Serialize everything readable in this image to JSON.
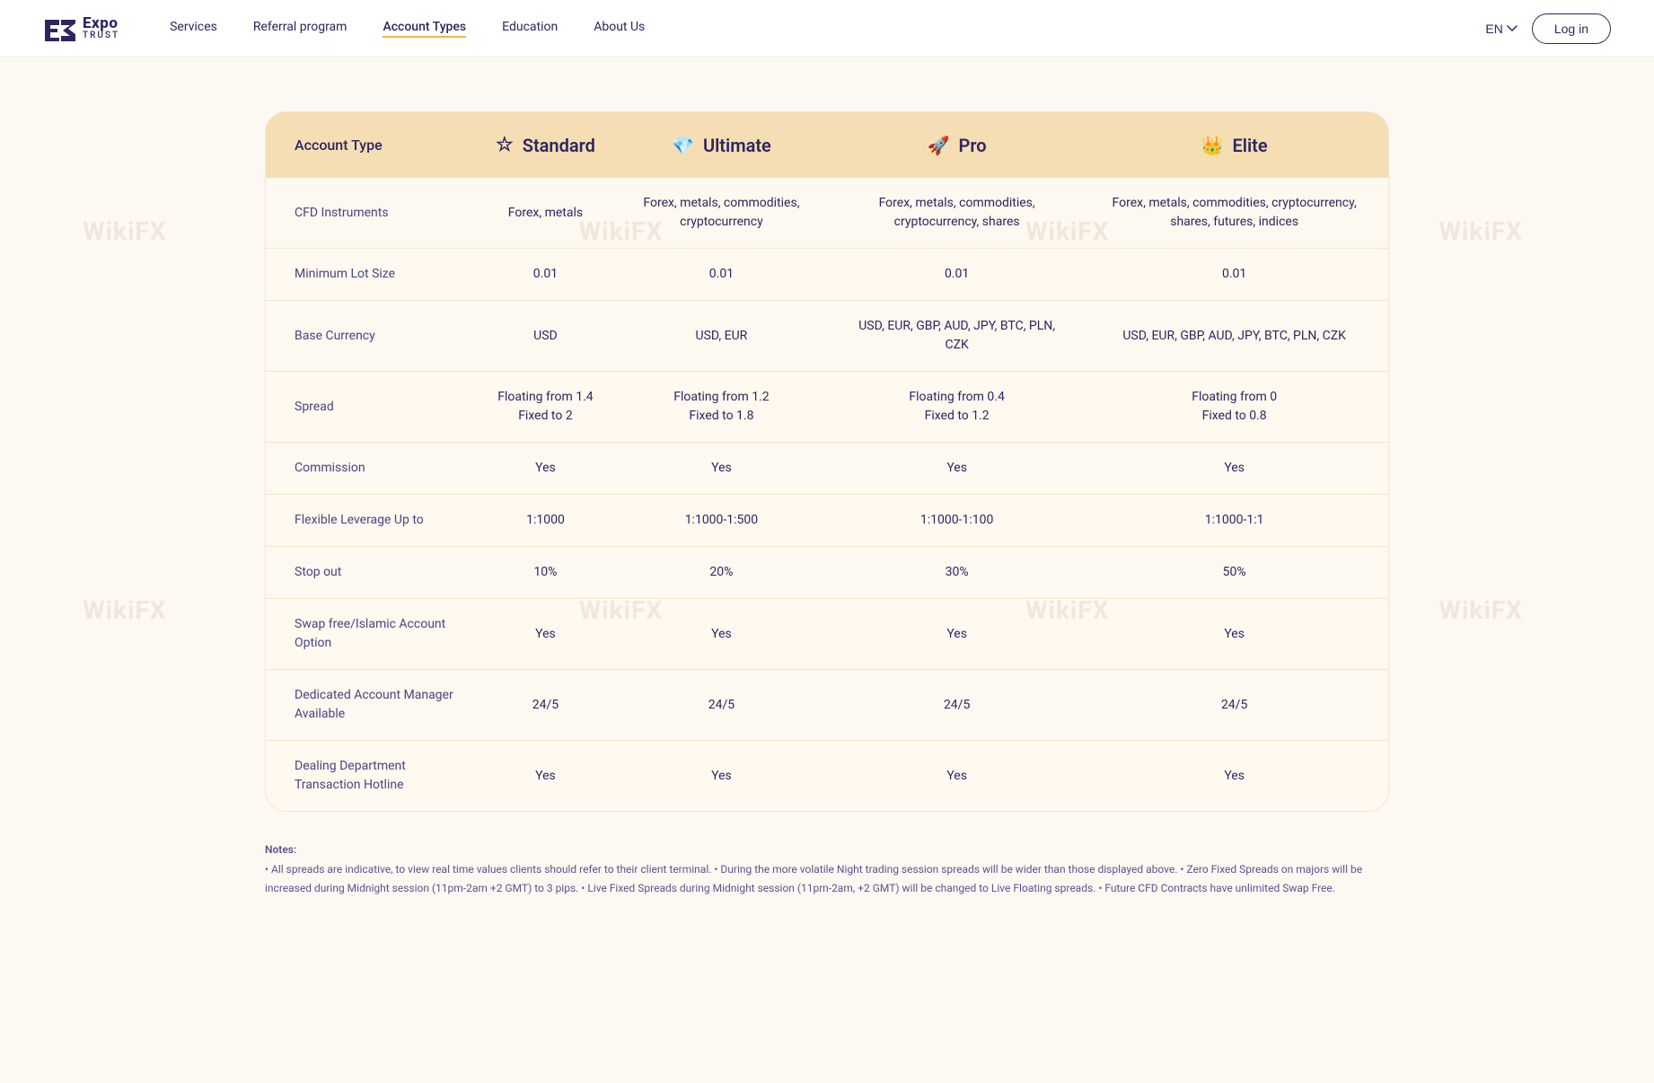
{
  "site": {
    "logo_expo": "Expo",
    "logo_trust": "TRUST",
    "nav": {
      "links": [
        {
          "label": "Services",
          "active": false
        },
        {
          "label": "Referral program",
          "active": false
        },
        {
          "label": "Account Types",
          "active": true
        },
        {
          "label": "Education",
          "active": false
        },
        {
          "label": "About Us",
          "active": false
        }
      ],
      "lang": "EN",
      "login": "Log in"
    }
  },
  "table": {
    "header": {
      "col0": "Account Type",
      "col1_label": "Standard",
      "col1_icon": "☆",
      "col2_label": "Ultimate",
      "col2_icon": "💎",
      "col3_label": "Pro",
      "col3_icon": "🚀",
      "col4_label": "Elite",
      "col4_icon": "👑"
    },
    "rows": [
      {
        "feature": "CFD Instruments",
        "standard": "Forex, metals",
        "ultimate": "Forex, metals, commodities, cryptocurrency",
        "pro": "Forex, metals, commodities, cryptocurrency, shares",
        "elite": "Forex, metals, commodities, cryptocurrency, shares, futures, indices"
      },
      {
        "feature": "Minimum Lot Size",
        "standard": "0.01",
        "ultimate": "0.01",
        "pro": "0.01",
        "elite": "0.01"
      },
      {
        "feature": "Base Currency",
        "standard": "USD",
        "ultimate": "USD, EUR",
        "pro": "USD, EUR, GBP, AUD, JPY, BTC, PLN, CZK",
        "elite": "USD, EUR, GBP, AUD, JPY, BTC, PLN, CZK"
      },
      {
        "feature": "Spread",
        "standard": "Floating from 1.4\nFixed to 2",
        "ultimate": "Floating from 1.2\nFixed to 1.8",
        "pro": "Floating from 0.4\nFixed to 1.2",
        "elite": "Floating from 0\nFixed to 0.8"
      },
      {
        "feature": "Commission",
        "standard": "Yes",
        "ultimate": "Yes",
        "pro": "Yes",
        "elite": "Yes"
      },
      {
        "feature": "Flexible Leverage Up to",
        "standard": "1:1000",
        "ultimate": "1:1000-1:500",
        "pro": "1:1000-1:100",
        "elite": "1:1000-1:1"
      },
      {
        "feature": "Stop out",
        "standard": "10%",
        "ultimate": "20%",
        "pro": "30%",
        "elite": "50%"
      },
      {
        "feature": "Swap free/Islamic Account Option",
        "standard": "Yes",
        "ultimate": "Yes",
        "pro": "Yes",
        "elite": "Yes"
      },
      {
        "feature": "Dedicated Account Manager Available",
        "standard": "24/5",
        "ultimate": "24/5",
        "pro": "24/5",
        "elite": "24/5"
      },
      {
        "feature": "Dealing Department Transaction Hotline",
        "standard": "Yes",
        "ultimate": "Yes",
        "pro": "Yes",
        "elite": "Yes"
      }
    ]
  },
  "notes": {
    "title": "Notes:",
    "lines": [
      "• All spreads are indicative, to view real time values clients should refer to their client terminal. • During the more volatile Night trading session spreads will be wider than those displayed above. • Zero Fixed Spreads on majors will be increased during Midnight session (11pm-2am +2 GMT) to 3 pips. • Live Fixed Spreads during Midnight session (11pm-2am, +2 GMT) will be changed to Live Floating spreads. • Future CFD Contracts have unlimited Swap Free."
    ]
  }
}
